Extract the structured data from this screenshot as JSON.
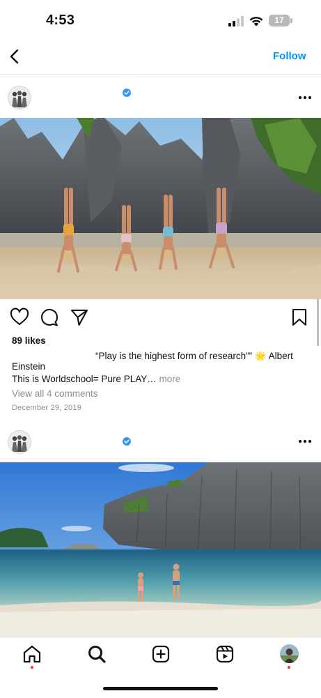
{
  "status_bar": {
    "time": "4:53",
    "battery_level": "17",
    "icons": [
      "cellular-signal-icon",
      "wifi-icon",
      "battery-icon"
    ]
  },
  "header": {
    "back_icon": "chevron-left-icon",
    "follow_label": "Follow"
  },
  "posts": [
    {
      "avatar_icon": "profile-avatar",
      "verified_icon": "verified-badge-icon",
      "more_icon": "more-options-icon",
      "photo": "four people doing handstands on a beach between limestone cliffs",
      "actions": [
        "heart-icon",
        "comment-icon",
        "share-icon",
        "bookmark-icon"
      ],
      "likes": "89 likes",
      "caption_line1": "“Play is the highest form of research”” 🌟 Albert",
      "caption_line2": "Einstein",
      "caption_line3": "This is Worldschool= Pure PLAY…",
      "more_label": "more",
      "view_comments": "View all 4 comments",
      "date": "December 29, 2019"
    },
    {
      "avatar_icon": "profile-avatar",
      "verified_icon": "verified-badge-icon",
      "more_icon": "more-options-icon",
      "photo": "two people walking into a clear lagoon under a limestone cliff"
    }
  ],
  "bottom_nav": {
    "items": [
      "home-icon",
      "search-icon",
      "create-post-icon",
      "reels-icon",
      "profile-avatar"
    ]
  },
  "colors": {
    "accent": "#0095f6",
    "notification_dot": "#ff3040",
    "verified": "#3897f0"
  }
}
